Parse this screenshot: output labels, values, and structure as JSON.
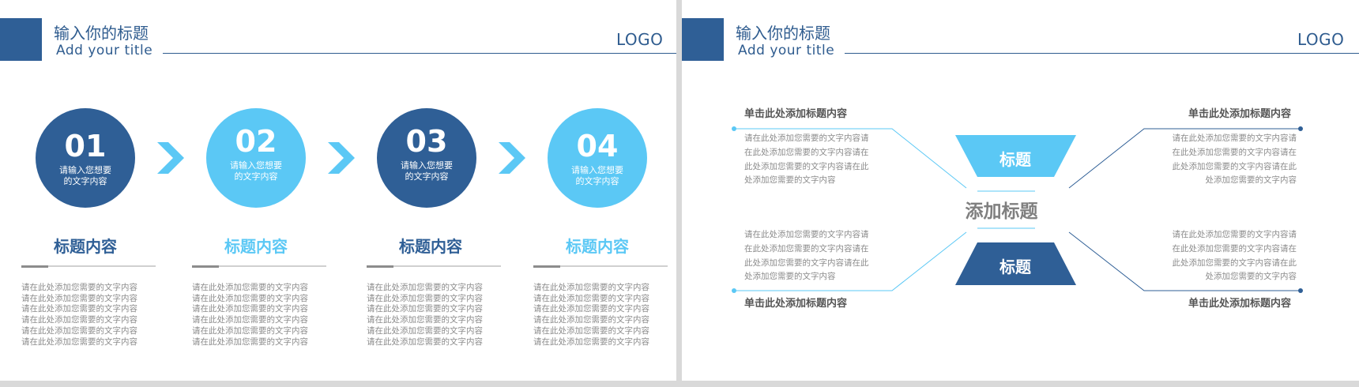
{
  "colors": {
    "dark_blue": "#2f5f96",
    "light_blue": "#5bc8f5",
    "chevron": "#5bc8f5",
    "title_text": "#2f5c8f",
    "body_gray": "#8c8c8c"
  },
  "slide1": {
    "header": {
      "title": "输入你的标题",
      "subtitle": "Add your title",
      "logo": "LOGO"
    },
    "steps": [
      {
        "num": "01",
        "text": "请输入您想要的文字内容",
        "title": "标题内容",
        "color": "dark"
      },
      {
        "num": "02",
        "text": "请输入您想要的文字内容",
        "title": "标题内容",
        "color": "light"
      },
      {
        "num": "03",
        "text": "请输入您想要的文字内容",
        "title": "标题内容",
        "color": "dark"
      },
      {
        "num": "04",
        "text": "请输入您想要的文字内容",
        "title": "标题内容",
        "color": "light"
      }
    ],
    "step_text_lines": [
      "请输入您想要",
      "的文字内容"
    ],
    "column_body": "请在此处添加您需要的文字内容\n请在此处添加您需要的文字内容\n请在此处添加您需要的文字内容\n请在此处添加您需要的文字内容\n请在此处添加您需要的文字内容\n请在此处添加您需要的文字内容",
    "chevron_icon": "chevron-right-icon"
  },
  "slide2": {
    "header": {
      "title": "输入你的标题",
      "subtitle": "Add your title",
      "logo": "LOGO"
    },
    "center_label": "添加标题",
    "top_trapezoid_label": "标题",
    "bottom_trapezoid_label": "标题",
    "left_top": {
      "heading": "单击此处添加标题内容",
      "body": "请在此处添加您需要的文字内容请\n在此处添加您需要的文字内容请在\n此处添加您需要的文字内容请在此\n处添加您需要的文字内容"
    },
    "left_bottom": {
      "heading": "单击此处添加标题内容",
      "body": "请在此处添加您需要的文字内容请\n在此处添加您需要的文字内容请在\n此处添加您需要的文字内容请在此\n处添加您需要的文字内容"
    },
    "right_top": {
      "heading": "单击此处添加标题内容",
      "body": "请在此处添加您需要的文字内容请\n在此处添加您需要的文字内容请在\n此处添加您需要的文字内容请在此\n处添加您需要的文字内容"
    },
    "right_bottom": {
      "heading": "单击此处添加标题内容",
      "body": "请在此处添加您需要的文字内容请\n在此处添加您需要的文字内容请在\n此处添加您需要的文字内容请在此\n处添加您需要的文字内容"
    }
  }
}
